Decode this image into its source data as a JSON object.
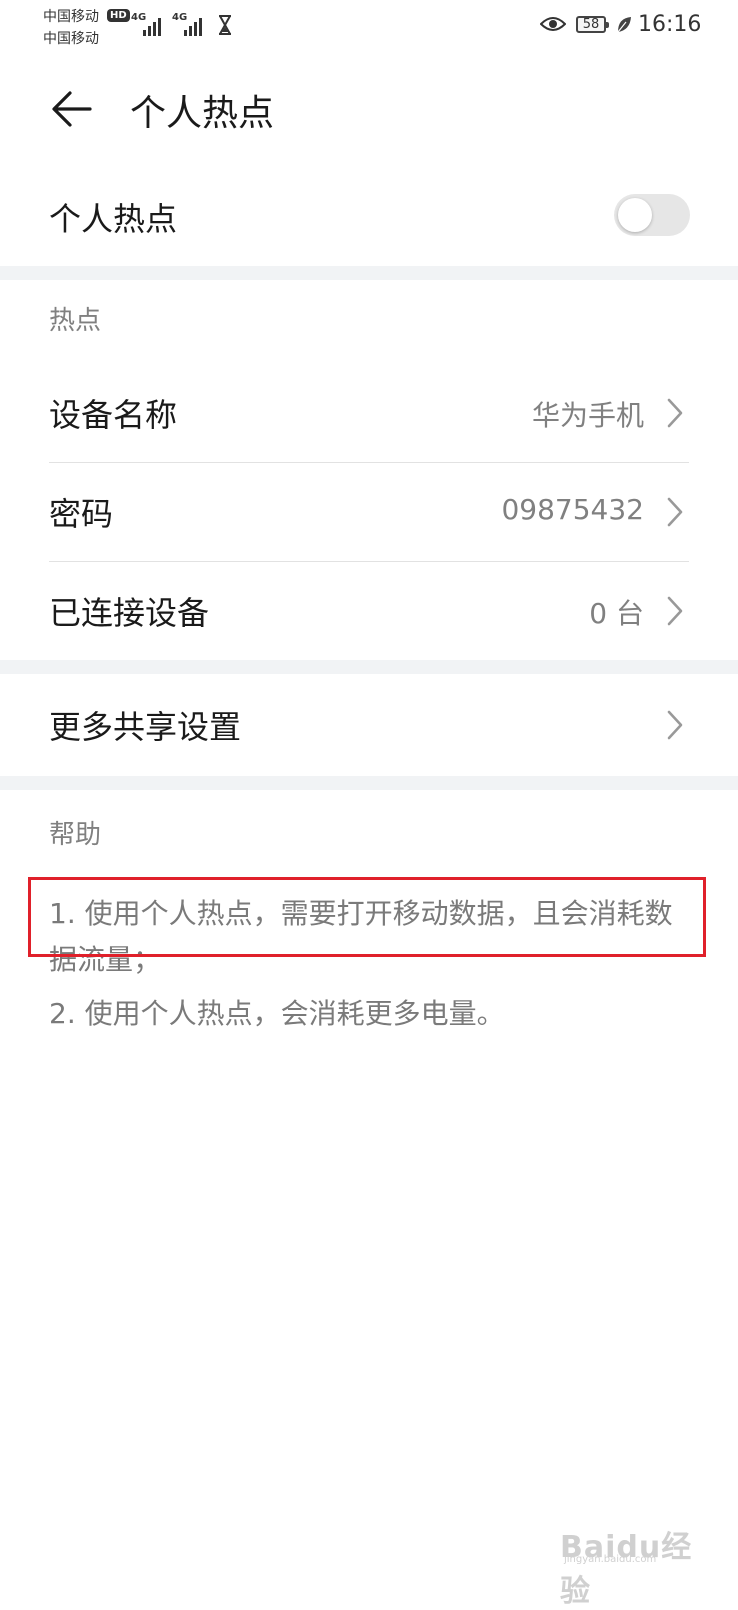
{
  "status_bar": {
    "carrier_1": "中国移动",
    "carrier_2": "中国移动",
    "hd_badge": "HD",
    "signal_1_label": "4G",
    "signal_2_label": "4G",
    "battery_level": "58",
    "time": "16:16",
    "icons": [
      "signal-icon",
      "hourglass-icon",
      "eye-icon",
      "battery-icon",
      "leaf-icon"
    ]
  },
  "header": {
    "title": "个人热点",
    "back_icon": "arrow-left-icon"
  },
  "hotspot_toggle": {
    "label": "个人热点",
    "enabled": false
  },
  "hotspot_section": {
    "header": "热点",
    "rows": [
      {
        "label": "设备名称",
        "value": "华为手机"
      },
      {
        "label": "密码",
        "value": "09875432"
      },
      {
        "label": "已连接设备",
        "value": "0 台"
      }
    ]
  },
  "more_section": {
    "label": "更多共享设置"
  },
  "help_section": {
    "header": "帮助",
    "items": [
      "1. 使用个人热点，需要打开移动数据，且会消耗数据流量；",
      "2. 使用个人热点，会消耗更多电量。"
    ]
  },
  "watermark": {
    "text": "Baidu经验",
    "sub": "jingyan.baidu.com"
  },
  "colors": {
    "highlight": "#e0202a",
    "section_gap": "#f1f3f5",
    "secondary_text": "#808080"
  }
}
